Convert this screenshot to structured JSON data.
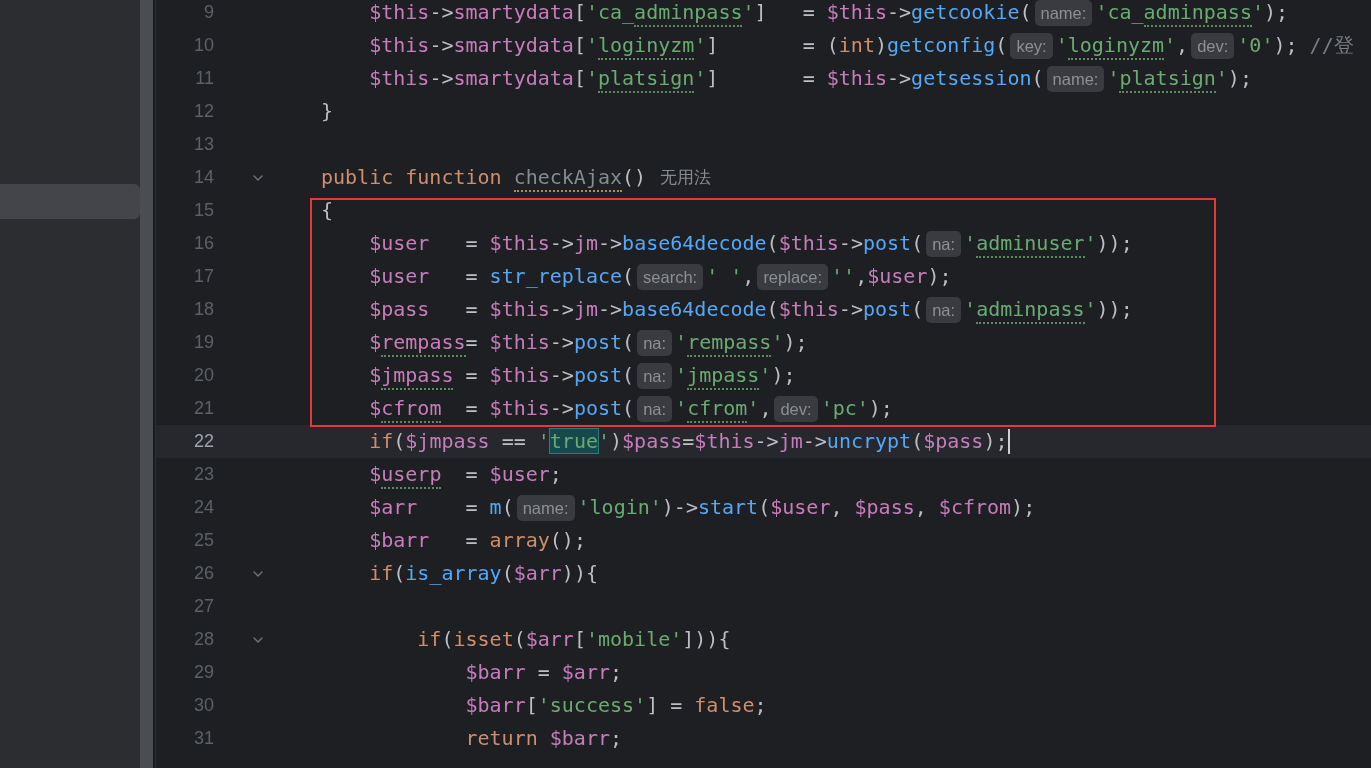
{
  "editor": {
    "lines": [
      {
        "number": "9",
        "boxed": false,
        "current": false,
        "foldable": false,
        "caret": false,
        "tokens": [
          {
            "text": "    $this",
            "kind": "var"
          },
          {
            "text": "->",
            "kind": "plain"
          },
          {
            "text": "smartydata",
            "kind": "var"
          },
          {
            "text": "[",
            "kind": "plain"
          },
          {
            "text": "'ca_",
            "kind": "str"
          },
          {
            "text": "adminpass",
            "kind": "str",
            "typo": true
          },
          {
            "text": "'",
            "kind": "str"
          },
          {
            "text": "]   = ",
            "kind": "plain"
          },
          {
            "text": "$this",
            "kind": "var"
          },
          {
            "text": "->",
            "kind": "plain"
          },
          {
            "text": "getcookie",
            "kind": "fn"
          },
          {
            "text": "(",
            "kind": "plain"
          },
          {
            "text": "name:",
            "kind": "hint"
          },
          {
            "text": "'ca_",
            "kind": "str"
          },
          {
            "text": "adminpass",
            "kind": "str",
            "typo": true
          },
          {
            "text": "'",
            "kind": "str"
          },
          {
            "text": ");",
            "kind": "plain"
          }
        ]
      },
      {
        "number": "10",
        "boxed": false,
        "current": false,
        "foldable": false,
        "caret": false,
        "tokens": [
          {
            "text": "    $this",
            "kind": "var"
          },
          {
            "text": "->",
            "kind": "plain"
          },
          {
            "text": "smartydata",
            "kind": "var"
          },
          {
            "text": "[",
            "kind": "plain"
          },
          {
            "text": "'",
            "kind": "str"
          },
          {
            "text": "loginyzm",
            "kind": "str",
            "typo": true
          },
          {
            "text": "'",
            "kind": "str"
          },
          {
            "text": "]       = (",
            "kind": "plain"
          },
          {
            "text": "int",
            "kind": "kw"
          },
          {
            "text": ")",
            "kind": "plain"
          },
          {
            "text": "getconfig",
            "kind": "fn"
          },
          {
            "text": "(",
            "kind": "plain"
          },
          {
            "text": "key:",
            "kind": "hint"
          },
          {
            "text": "'",
            "kind": "str"
          },
          {
            "text": "loginyzm",
            "kind": "str",
            "typo": true
          },
          {
            "text": "'",
            "kind": "str"
          },
          {
            "text": ",",
            "kind": "plain"
          },
          {
            "text": "dev:",
            "kind": "hint"
          },
          {
            "text": "'0'",
            "kind": "str"
          },
          {
            "text": ");",
            "kind": "plain"
          },
          {
            "text": " //登",
            "kind": "comment"
          }
        ]
      },
      {
        "number": "11",
        "boxed": false,
        "current": false,
        "foldable": false,
        "caret": false,
        "tokens": [
          {
            "text": "    $this",
            "kind": "var"
          },
          {
            "text": "->",
            "kind": "plain"
          },
          {
            "text": "smartydata",
            "kind": "var"
          },
          {
            "text": "[",
            "kind": "plain"
          },
          {
            "text": "'",
            "kind": "str"
          },
          {
            "text": "platsign",
            "kind": "str",
            "typo": true
          },
          {
            "text": "'",
            "kind": "str"
          },
          {
            "text": "]       = ",
            "kind": "plain"
          },
          {
            "text": "$this",
            "kind": "var"
          },
          {
            "text": "->",
            "kind": "plain"
          },
          {
            "text": "getsession",
            "kind": "fn"
          },
          {
            "text": "(",
            "kind": "plain"
          },
          {
            "text": "name:",
            "kind": "hint"
          },
          {
            "text": "'",
            "kind": "str"
          },
          {
            "text": "platsign",
            "kind": "str",
            "typo": true
          },
          {
            "text": "'",
            "kind": "str"
          },
          {
            "text": ");",
            "kind": "plain"
          }
        ]
      },
      {
        "number": "12",
        "boxed": false,
        "current": false,
        "foldable": false,
        "caret": false,
        "tokens": [
          {
            "text": "}",
            "kind": "plain"
          }
        ]
      },
      {
        "number": "13",
        "boxed": false,
        "current": false,
        "foldable": false,
        "caret": false
      },
      {
        "number": "14",
        "boxed": false,
        "current": false,
        "foldable": true,
        "caret": false,
        "tokens": [
          {
            "text": "public function ",
            "kind": "kw"
          },
          {
            "text": "checkAjax",
            "kind": "unused",
            "typo": true
          },
          {
            "text": "()",
            "kind": "plain"
          },
          {
            "text": "无用法",
            "kind": "usage"
          }
        ]
      },
      {
        "number": "15",
        "boxed": true,
        "current": false,
        "foldable": false,
        "caret": false,
        "tokens": [
          {
            "text": "{",
            "kind": "plain"
          }
        ]
      },
      {
        "number": "16",
        "boxed": true,
        "current": false,
        "foldable": false,
        "caret": false,
        "tokens": [
          {
            "text": "    $user",
            "kind": "var"
          },
          {
            "text": "   = ",
            "kind": "plain"
          },
          {
            "text": "$this",
            "kind": "var"
          },
          {
            "text": "->",
            "kind": "plain"
          },
          {
            "text": "jm",
            "kind": "var"
          },
          {
            "text": "->",
            "kind": "plain"
          },
          {
            "text": "base64decode",
            "kind": "fn"
          },
          {
            "text": "(",
            "kind": "plain"
          },
          {
            "text": "$this",
            "kind": "var"
          },
          {
            "text": "->",
            "kind": "plain"
          },
          {
            "text": "post",
            "kind": "fn"
          },
          {
            "text": "(",
            "kind": "plain"
          },
          {
            "text": "na:",
            "kind": "hint"
          },
          {
            "text": "'",
            "kind": "str"
          },
          {
            "text": "adminuser",
            "kind": "str",
            "typo": true
          },
          {
            "text": "'",
            "kind": "str"
          },
          {
            "text": "));",
            "kind": "plain"
          }
        ]
      },
      {
        "number": "17",
        "boxed": true,
        "current": false,
        "foldable": false,
        "caret": false,
        "tokens": [
          {
            "text": "    $user",
            "kind": "var"
          },
          {
            "text": "   = ",
            "kind": "plain"
          },
          {
            "text": "str_replace",
            "kind": "fn"
          },
          {
            "text": "(",
            "kind": "plain"
          },
          {
            "text": "search:",
            "kind": "hint"
          },
          {
            "text": "' '",
            "kind": "str"
          },
          {
            "text": ",",
            "kind": "plain"
          },
          {
            "text": "replace:",
            "kind": "hint"
          },
          {
            "text": "''",
            "kind": "str"
          },
          {
            "text": ",",
            "kind": "plain"
          },
          {
            "text": "$user",
            "kind": "var"
          },
          {
            "text": ");",
            "kind": "plain"
          }
        ]
      },
      {
        "number": "18",
        "boxed": true,
        "current": false,
        "foldable": false,
        "caret": false,
        "tokens": [
          {
            "text": "    $pass",
            "kind": "var"
          },
          {
            "text": "   = ",
            "kind": "plain"
          },
          {
            "text": "$this",
            "kind": "var"
          },
          {
            "text": "->",
            "kind": "plain"
          },
          {
            "text": "jm",
            "kind": "var"
          },
          {
            "text": "->",
            "kind": "plain"
          },
          {
            "text": "base64decode",
            "kind": "fn"
          },
          {
            "text": "(",
            "kind": "plain"
          },
          {
            "text": "$this",
            "kind": "var"
          },
          {
            "text": "->",
            "kind": "plain"
          },
          {
            "text": "post",
            "kind": "fn"
          },
          {
            "text": "(",
            "kind": "plain"
          },
          {
            "text": "na:",
            "kind": "hint"
          },
          {
            "text": "'",
            "kind": "str"
          },
          {
            "text": "adminpass",
            "kind": "str",
            "typo": true
          },
          {
            "text": "'",
            "kind": "str"
          },
          {
            "text": "));",
            "kind": "plain"
          }
        ]
      },
      {
        "number": "19",
        "boxed": true,
        "current": false,
        "foldable": false,
        "caret": false,
        "tokens": [
          {
            "text": "    $",
            "kind": "var"
          },
          {
            "text": "rempass",
            "kind": "var",
            "typo": true
          },
          {
            "text": "= ",
            "kind": "plain"
          },
          {
            "text": "$this",
            "kind": "var"
          },
          {
            "text": "->",
            "kind": "plain"
          },
          {
            "text": "post",
            "kind": "fn"
          },
          {
            "text": "(",
            "kind": "plain"
          },
          {
            "text": "na:",
            "kind": "hint"
          },
          {
            "text": "'",
            "kind": "str"
          },
          {
            "text": "rempass",
            "kind": "str",
            "typo": true
          },
          {
            "text": "'",
            "kind": "str"
          },
          {
            "text": ");",
            "kind": "plain"
          }
        ]
      },
      {
        "number": "20",
        "boxed": true,
        "current": false,
        "foldable": false,
        "caret": false,
        "tokens": [
          {
            "text": "    $",
            "kind": "var"
          },
          {
            "text": "jmpass",
            "kind": "var",
            "typo": true
          },
          {
            "text": " = ",
            "kind": "plain"
          },
          {
            "text": "$this",
            "kind": "var"
          },
          {
            "text": "->",
            "kind": "plain"
          },
          {
            "text": "post",
            "kind": "fn"
          },
          {
            "text": "(",
            "kind": "plain"
          },
          {
            "text": "na:",
            "kind": "hint"
          },
          {
            "text": "'",
            "kind": "str"
          },
          {
            "text": "jmpass",
            "kind": "str",
            "typo": true
          },
          {
            "text": "'",
            "kind": "str"
          },
          {
            "text": ");",
            "kind": "plain"
          }
        ]
      },
      {
        "number": "21",
        "boxed": true,
        "current": false,
        "foldable": false,
        "caret": false,
        "tokens": [
          {
            "text": "    $",
            "kind": "var"
          },
          {
            "text": "cfrom",
            "kind": "var",
            "typo": true
          },
          {
            "text": "  = ",
            "kind": "plain"
          },
          {
            "text": "$this",
            "kind": "var"
          },
          {
            "text": "->",
            "kind": "plain"
          },
          {
            "text": "post",
            "kind": "fn"
          },
          {
            "text": "(",
            "kind": "plain"
          },
          {
            "text": "na:",
            "kind": "hint"
          },
          {
            "text": "'",
            "kind": "str"
          },
          {
            "text": "cfrom",
            "kind": "str",
            "typo": true
          },
          {
            "text": "'",
            "kind": "str"
          },
          {
            "text": ",",
            "kind": "plain"
          },
          {
            "text": "dev:",
            "kind": "hint"
          },
          {
            "text": "'pc'",
            "kind": "str"
          },
          {
            "text": ");",
            "kind": "plain"
          }
        ]
      },
      {
        "number": "22",
        "boxed": false,
        "current": true,
        "foldable": false,
        "caret": true,
        "tokens": [
          {
            "text": "    if",
            "kind": "kw"
          },
          {
            "text": "(",
            "kind": "plain"
          },
          {
            "text": "$jmpass",
            "kind": "var"
          },
          {
            "text": " == ",
            "kind": "plain"
          },
          {
            "text": "'",
            "kind": "str"
          },
          {
            "text": "true",
            "kind": "str",
            "match": true
          },
          {
            "text": "'",
            "kind": "str"
          },
          {
            "text": ")",
            "kind": "plain"
          },
          {
            "text": "$pass",
            "kind": "var"
          },
          {
            "text": "=",
            "kind": "plain"
          },
          {
            "text": "$this",
            "kind": "var"
          },
          {
            "text": "->",
            "kind": "plain"
          },
          {
            "text": "jm",
            "kind": "var"
          },
          {
            "text": "->",
            "kind": "plain"
          },
          {
            "text": "uncrypt",
            "kind": "fn"
          },
          {
            "text": "(",
            "kind": "plain"
          },
          {
            "text": "$pass",
            "kind": "var"
          },
          {
            "text": ");",
            "kind": "plain"
          }
        ]
      },
      {
        "number": "23",
        "boxed": false,
        "current": false,
        "foldable": false,
        "caret": false,
        "tokens": [
          {
            "text": "    $",
            "kind": "var"
          },
          {
            "text": "userp",
            "kind": "var",
            "typo": true
          },
          {
            "text": "  = ",
            "kind": "plain"
          },
          {
            "text": "$user",
            "kind": "var"
          },
          {
            "text": ";",
            "kind": "plain"
          }
        ]
      },
      {
        "number": "24",
        "boxed": false,
        "current": false,
        "foldable": false,
        "caret": false,
        "tokens": [
          {
            "text": "    $arr",
            "kind": "var"
          },
          {
            "text": "    = ",
            "kind": "plain"
          },
          {
            "text": "m",
            "kind": "fn"
          },
          {
            "text": "(",
            "kind": "plain"
          },
          {
            "text": "name:",
            "kind": "hint"
          },
          {
            "text": "'login'",
            "kind": "str"
          },
          {
            "text": ")->",
            "kind": "plain"
          },
          {
            "text": "start",
            "kind": "fn"
          },
          {
            "text": "(",
            "kind": "plain"
          },
          {
            "text": "$user",
            "kind": "var"
          },
          {
            "text": ", ",
            "kind": "plain"
          },
          {
            "text": "$pass",
            "kind": "var"
          },
          {
            "text": ", ",
            "kind": "plain"
          },
          {
            "text": "$cfrom",
            "kind": "var"
          },
          {
            "text": ");",
            "kind": "plain"
          }
        ]
      },
      {
        "number": "25",
        "boxed": false,
        "current": false,
        "foldable": false,
        "caret": false,
        "tokens": [
          {
            "text": "    $barr",
            "kind": "var"
          },
          {
            "text": "   = ",
            "kind": "plain"
          },
          {
            "text": "array",
            "kind": "kw"
          },
          {
            "text": "();",
            "kind": "plain"
          }
        ]
      },
      {
        "number": "26",
        "boxed": false,
        "current": false,
        "foldable": true,
        "caret": false,
        "tokens": [
          {
            "text": "    if",
            "kind": "kw"
          },
          {
            "text": "(",
            "kind": "plain"
          },
          {
            "text": "is_array",
            "kind": "fn"
          },
          {
            "text": "(",
            "kind": "plain"
          },
          {
            "text": "$arr",
            "kind": "var"
          },
          {
            "text": ")){",
            "kind": "plain"
          }
        ]
      },
      {
        "number": "27",
        "boxed": false,
        "current": false,
        "foldable": false,
        "caret": false
      },
      {
        "number": "28",
        "boxed": false,
        "current": false,
        "foldable": true,
        "caret": false,
        "tokens": [
          {
            "text": "        if",
            "kind": "kw"
          },
          {
            "text": "(",
            "kind": "plain"
          },
          {
            "text": "isset",
            "kind": "kw"
          },
          {
            "text": "(",
            "kind": "plain"
          },
          {
            "text": "$arr",
            "kind": "var"
          },
          {
            "text": "[",
            "kind": "plain"
          },
          {
            "text": "'mobile'",
            "kind": "str"
          },
          {
            "text": "])){",
            "kind": "plain"
          }
        ]
      },
      {
        "number": "29",
        "boxed": false,
        "current": false,
        "foldable": false,
        "caret": false,
        "tokens": [
          {
            "text": "            $barr",
            "kind": "var"
          },
          {
            "text": " = ",
            "kind": "plain"
          },
          {
            "text": "$arr",
            "kind": "var"
          },
          {
            "text": ";",
            "kind": "plain"
          }
        ]
      },
      {
        "number": "30",
        "boxed": false,
        "current": false,
        "foldable": false,
        "caret": false,
        "tokens": [
          {
            "text": "            $barr",
            "kind": "var"
          },
          {
            "text": "[",
            "kind": "plain"
          },
          {
            "text": "'success'",
            "kind": "str"
          },
          {
            "text": "] = ",
            "kind": "plain"
          },
          {
            "text": "false",
            "kind": "kw"
          },
          {
            "text": ";",
            "kind": "plain"
          }
        ]
      },
      {
        "number": "31",
        "boxed": false,
        "current": false,
        "foldable": false,
        "caret": false,
        "tokens": [
          {
            "text": "            return ",
            "kind": "kw"
          },
          {
            "text": "$barr",
            "kind": "var"
          },
          {
            "text": ";",
            "kind": "plain"
          }
        ]
      }
    ]
  }
}
